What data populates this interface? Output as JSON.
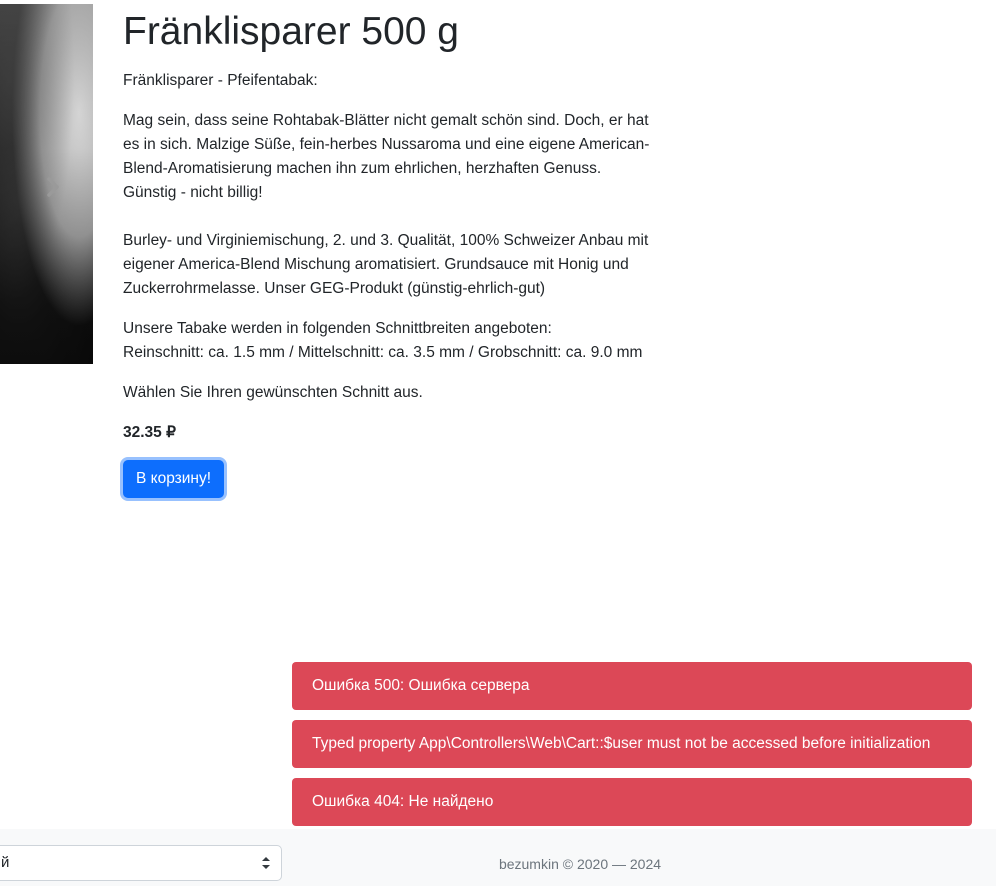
{
  "product": {
    "title": "Fränklisparer 500 g",
    "subtitle": "Fränklisparer - Pfeifentabak:",
    "description_lines_1": [
      "Mag sein, dass seine Rohtabak-Blätter nicht gemalt schön sind. Doch, er hat",
      "es in sich. Malzige Süße, fein-herbes Nussaroma und eine eigene American-",
      "Blend-Aromatisierung machen ihn zum ehrlichen, herzhaften Genuss.",
      "Günstig - nicht billig!"
    ],
    "description_lines_2": [
      "Burley- und Virginiemischung, 2. und 3. Qualität, 100% Schweizer Anbau mit",
      "eigener America-Blend Mischung aromatisiert. Grundsauce mit Honig und",
      "Zuckerrohrmelasse. Unser GEG-Produkt (günstig-ehrlich-gut)"
    ],
    "cut_lines": [
      "Unsere Tabake werden in folgenden Schnittbreiten angeboten:",
      "Reinschnitt: ca. 1.5 mm / Mittelschnitt: ca. 3.5 mm / Grobschnitt: ca. 9.0 mm"
    ],
    "choose_text": "Wählen Sie Ihren gewünschten Schnitt aus.",
    "price": "32.35 ₽",
    "add_to_cart_label": "В корзину!"
  },
  "carousel": {
    "next_icon": "chevron-right-icon"
  },
  "alerts": [
    "Ошибка 500: Ошибка сервера",
    "Typed property App\\Controllers\\Web\\Cart::$user must not be accessed before initialization",
    "Ошибка 404: Не найдено"
  ],
  "footer": {
    "select_value": "й",
    "copyright": "bezumkin © 2020 — 2024"
  },
  "colors": {
    "primary": "#0d6efd",
    "danger": "#dc4857",
    "footer_bg": "#f8f9fa"
  }
}
